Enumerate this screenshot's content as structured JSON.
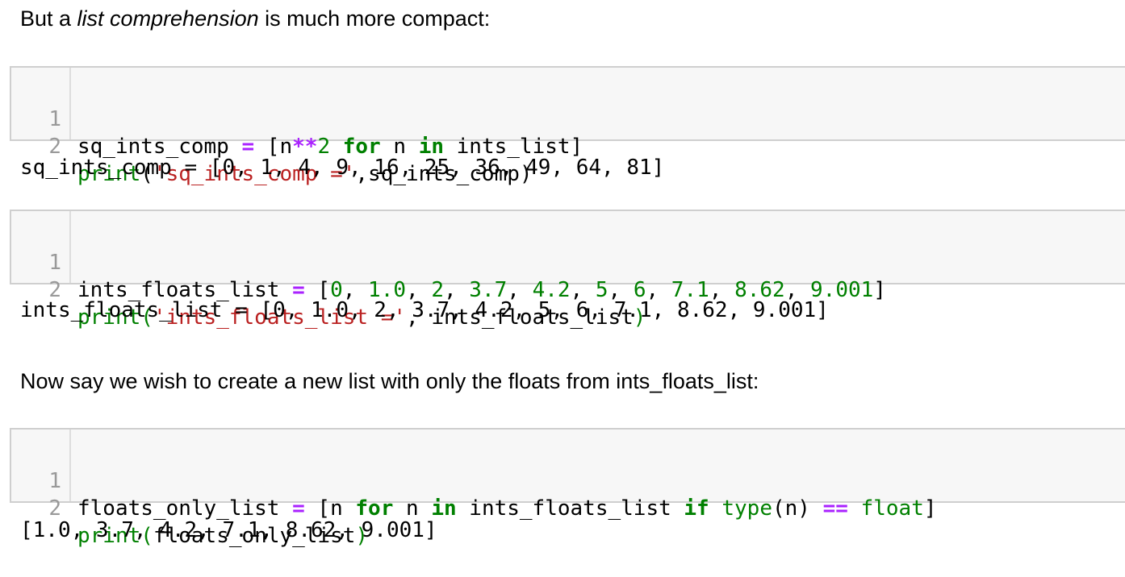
{
  "colors": {
    "keyword": "#008000",
    "operator": "#aa22ff",
    "number": "#008000",
    "string": "#ba2121",
    "builtin": "#008000",
    "cell_background": "#f7f7f7",
    "cell_border": "#cfcfcf",
    "line_number": "#999999"
  },
  "markdown": {
    "intro_prefix": "But a ",
    "intro_emphasis": "list comprehension",
    "intro_suffix": " is much more compact:",
    "floats_text": "Now say we wish to create a new list with only the floats from ints_floats_list:"
  },
  "cells": [
    {
      "line_numbers": [
        "1",
        "2"
      ],
      "tokens": {
        "l1_a": "sq_ints_comp ",
        "l1_eq": "=",
        "l1_b": " [n",
        "l1_pow": "**",
        "l1_two": "2",
        "l1_sp1": " ",
        "l1_for": "for",
        "l1_c": " n ",
        "l1_in": "in",
        "l1_d": " ints_list]",
        "l2_print": "print",
        "l2_paren": "(",
        "l2_str": "'sq_ints_comp ='",
        "l2_rest": ",sq_ints_comp)"
      },
      "output": "sq_ints_comp = [0, 1, 4, 9, 16, 25, 36, 49, 64, 81]"
    },
    {
      "line_numbers": [
        "1",
        "2"
      ],
      "tokens": {
        "l1_a": "ints_floats_list ",
        "l1_eq": "=",
        "l1_b": " [",
        "n0": "0",
        "c0": ", ",
        "n1": "1.0",
        "c1": ", ",
        "n2": "2",
        "c2": ", ",
        "n3": "3.7",
        "c3": ", ",
        "n4": "4.2",
        "c4": ", ",
        "n5": "5",
        "c5": ", ",
        "n6": "6",
        "c6": ", ",
        "n7": "7.1",
        "c7": ", ",
        "n8": "8.62",
        "c8": ", ",
        "n9": "9.001",
        "close": "]",
        "l2_print": "print",
        "l2_paren": "(",
        "l2_str": "'ints_floats_list ='",
        "l2_mid": ", ints_floats_list",
        "l2_close": ")"
      },
      "output": "ints_floats_list = [0, 1.0, 2, 3.7, 4.2, 5, 6, 7.1, 8.62, 9.001]"
    },
    {
      "line_numbers": [
        "1",
        "2"
      ],
      "tokens": {
        "l1_a": "floats_only_list ",
        "l1_eq": "=",
        "l1_b": " [n ",
        "l1_for": "for",
        "l1_c": " n ",
        "l1_in": "in",
        "l1_d": " ints_floats_list ",
        "l1_if": "if",
        "l1_sp": " ",
        "l1_type": "type",
        "l1_e": "(n) ",
        "l1_eqeq": "==",
        "l1_sp2": " ",
        "l1_float": "float",
        "l1_close": "]",
        "l2_print": "print",
        "l2_paren": "(",
        "l2_mid": "floats_only_list",
        "l2_close": ")"
      },
      "output": "[1.0, 3.7, 4.2, 7.1, 8.62, 9.001]"
    }
  ]
}
